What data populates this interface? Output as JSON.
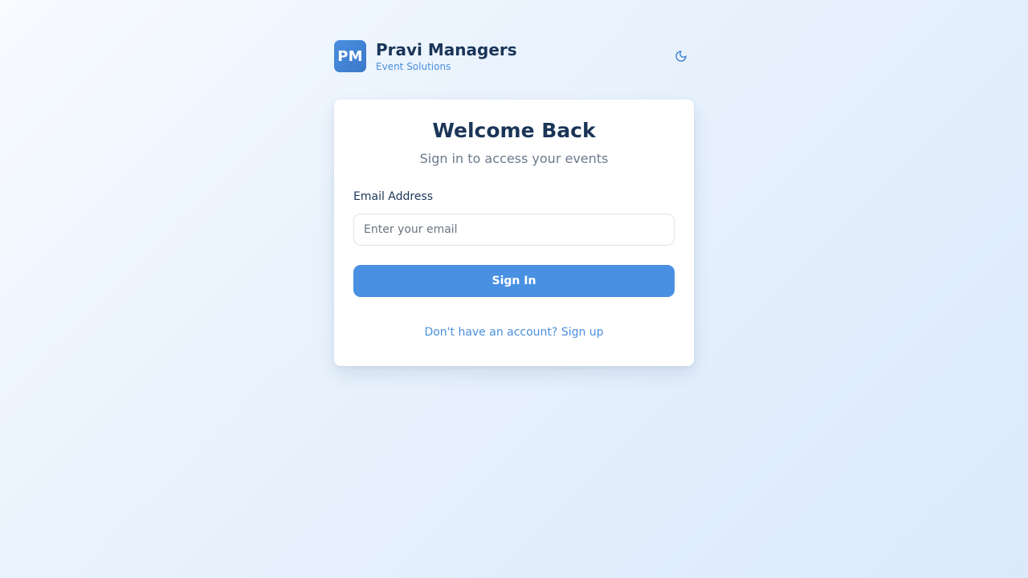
{
  "brand": {
    "logo_text": "PM",
    "name": "Pravi Managers",
    "tagline": "Event Solutions",
    "accent_color": "#4a90e2",
    "title_color": "#1b3558"
  },
  "header": {
    "theme_toggle_icon": "moon-icon"
  },
  "login": {
    "title": "Welcome Back",
    "subtitle": "Sign in to access your events",
    "email_label": "Email Address",
    "email_value": "",
    "email_placeholder": "Enter your email",
    "submit_label": "Sign In",
    "signup_text": "Don't have an account? Sign up"
  }
}
